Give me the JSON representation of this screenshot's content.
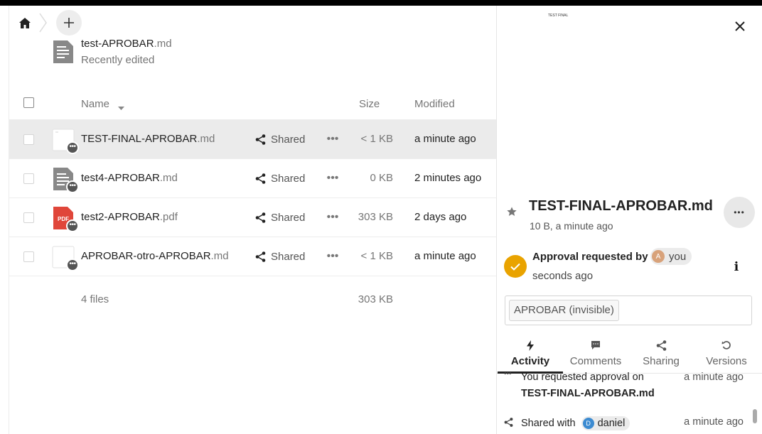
{
  "breadcrumb": {
    "home_icon": "home-icon",
    "add_icon": "plus-icon"
  },
  "recent": {
    "name": "test-APROBAR",
    "ext": ".md",
    "subtitle": "Recently edited"
  },
  "table": {
    "headers": {
      "name": "Name",
      "size": "Size",
      "modified": "Modified"
    },
    "rows": [
      {
        "name": "TEST-FINAL-APROBAR",
        "ext": ".md",
        "share_label": "Shared",
        "size": "< 1 KB",
        "modified": "a minute ago",
        "icon": "blank-file-icon",
        "selected": true
      },
      {
        "name": "test4-APROBAR",
        "ext": ".md",
        "share_label": "Shared",
        "size": "0 KB",
        "modified": "2 minutes ago",
        "icon": "text-file-icon",
        "selected": false
      },
      {
        "name": "test2-APROBAR",
        "ext": ".pdf",
        "share_label": "Shared",
        "size": "303 KB",
        "modified": "2 days ago",
        "icon": "pdf-file-icon",
        "icon_text": "PDF",
        "selected": false
      },
      {
        "name": "APROBAR-otro-APROBAR",
        "ext": ".md",
        "share_label": "Shared",
        "size": "< 1 KB",
        "modified": "a minute ago",
        "icon": "blank-file-icon",
        "selected": false
      }
    ],
    "summary": {
      "count": "4 files",
      "size": "303 KB"
    }
  },
  "sidebar": {
    "preview_text": "TEST FINAL",
    "title": "TEST-FINAL-APROBAR.md",
    "subtitle": "10 B, a minute ago",
    "approval": {
      "text": "Approval requested by",
      "user_initial": "A",
      "user": "you",
      "time": "seconds ago",
      "info_glyph": "i"
    },
    "tag": "APROBAR (invisible)",
    "tabs": [
      {
        "label": "Activity",
        "icon": "activity-icon",
        "active": true
      },
      {
        "label": "Comments",
        "icon": "comment-icon",
        "active": false
      },
      {
        "label": "Sharing",
        "icon": "share-icon",
        "active": false
      },
      {
        "label": "Versions",
        "icon": "history-icon",
        "active": false
      }
    ],
    "activity": [
      {
        "text": "You requested approval on",
        "file": "TEST-FINAL-APROBAR.md",
        "time": "a minute ago"
      },
      {
        "text": "Shared with",
        "user_initial": "D",
        "user": "daniel",
        "time": "a minute ago"
      }
    ]
  },
  "colors": {
    "accent_approval": "#e9a300",
    "pdf_red": "#e0463a",
    "selected_row": "#ebebeb"
  }
}
